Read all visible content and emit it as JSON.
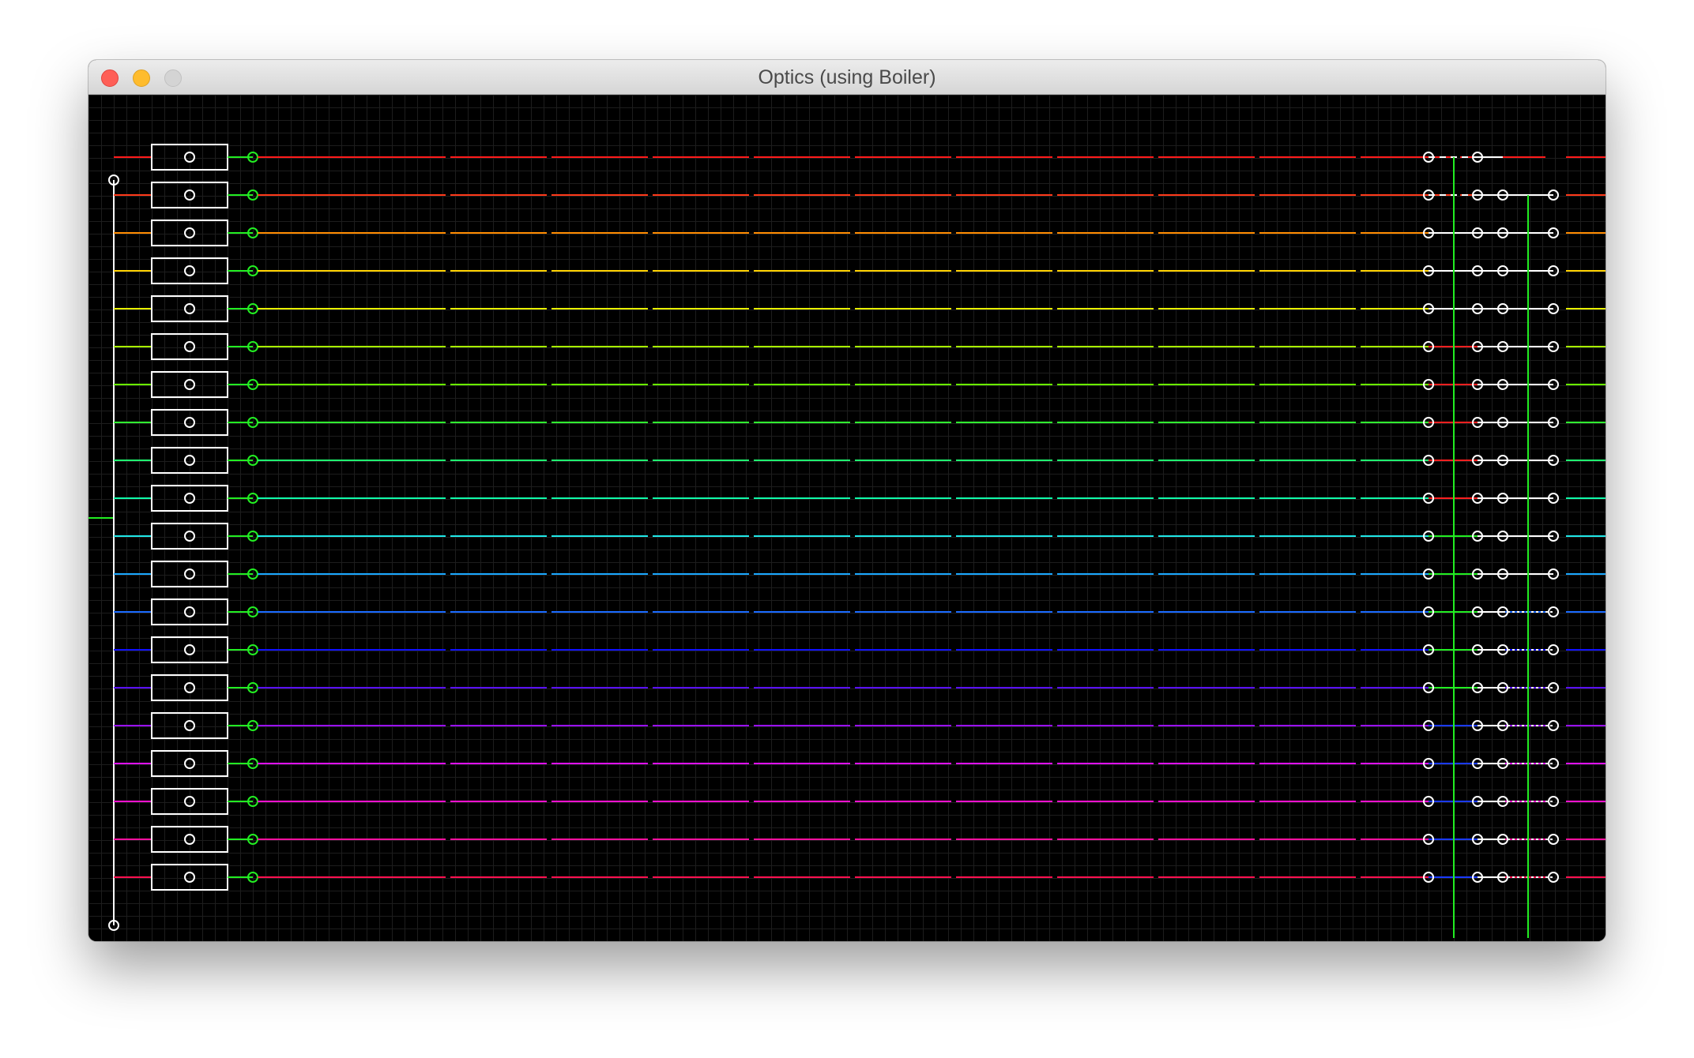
{
  "window": {
    "title": "Optics (using Boiler)"
  },
  "traffic_lights": {
    "close": "close-button",
    "minimize": "minimize-button",
    "zoom": "zoom-button"
  },
  "channel_colors": [
    "#ff1a1a",
    "#ff3a1a",
    "#ff8c00",
    "#ffd200",
    "#e8f000",
    "#a8ff00",
    "#6aff00",
    "#30ff30",
    "#20ff70",
    "#10ffaa",
    "#20e8e8",
    "#1aa8ff",
    "#1a6aff",
    "#1010ff",
    "#5a10ff",
    "#9a10ff",
    "#e010ff",
    "#ff10d0",
    "#ff10a0",
    "#ff1050"
  ],
  "signal_green": "#22ee22",
  "junction_color": "#ffffff",
  "grid_color": "#1d1d1d"
}
